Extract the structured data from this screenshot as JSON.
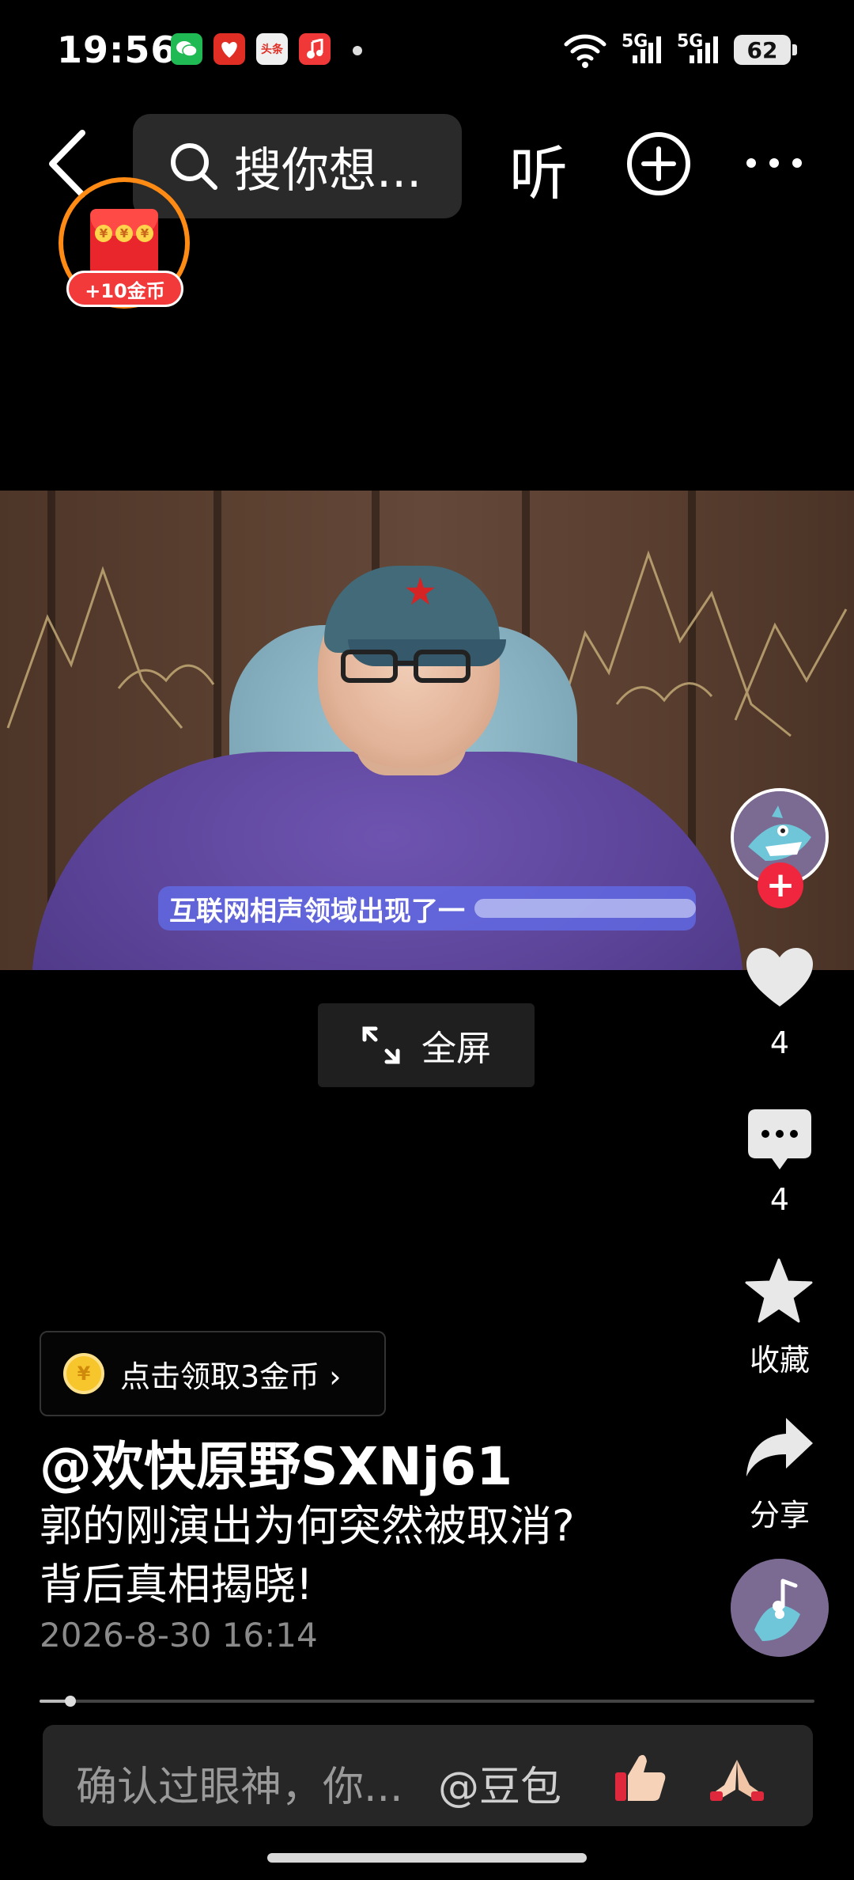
{
  "status_bar": {
    "time": "19:56",
    "apps": [
      {
        "name": "wechat-icon",
        "color": "#1fba53",
        "glyph": "💬"
      },
      {
        "name": "pinduoduo-icon",
        "color": "#e02e24",
        "glyph": "❖"
      },
      {
        "name": "toutiao-icon",
        "color": "#f0f0f0",
        "text": "头条"
      },
      {
        "name": "music-icon",
        "color": "#f03838",
        "glyph": "♪"
      }
    ],
    "network_1": "5G",
    "network_2": "5G",
    "battery": "62"
  },
  "top_nav": {
    "search_text": "搜你想...",
    "listen_label": "听"
  },
  "coin_widget": {
    "tag": "+10金币",
    "yen": "¥"
  },
  "video": {
    "subtitle": "互联网相声领域出现了一"
  },
  "fullscreen_label": "全屏",
  "rail": {
    "follow": "+",
    "like_count": "4",
    "comment_count": "4",
    "favorite_label": "收藏",
    "share_label": "分享"
  },
  "coin_chip": {
    "coin_glyph": "¥",
    "label": "点击领取3金币 ›"
  },
  "post": {
    "author": "@欢快原野SXNj61",
    "desc_line1": "郭的刚演出为何突然被取消?",
    "desc_line2": "背后真相揭晓!",
    "timestamp": "2026-8-30 16:14"
  },
  "playback": {
    "progress_fraction": 0.04
  },
  "comment_bar": {
    "placeholder": "确认过眼神，你...",
    "mention": "@豆包"
  },
  "colors": {
    "accent_red": "#f0263f",
    "coin_orange": "#ff8a14"
  }
}
